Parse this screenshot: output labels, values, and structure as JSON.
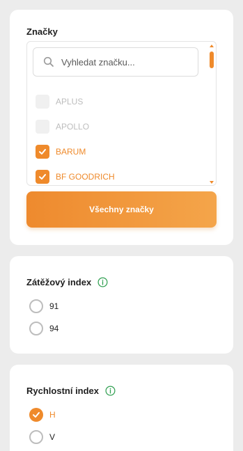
{
  "brands": {
    "title": "Značky",
    "search_placeholder": "Vyhledat značku...",
    "items": [
      {
        "label": "APLUS",
        "checked": false
      },
      {
        "label": "APOLLO",
        "checked": false
      },
      {
        "label": "BARUM",
        "checked": true
      },
      {
        "label": "BF GOODRICH",
        "checked": true
      }
    ],
    "all_button_label": "Všechny značky"
  },
  "load_index": {
    "title": "Zátěžový index",
    "options": [
      {
        "label": "91",
        "checked": false
      },
      {
        "label": "94",
        "checked": false
      }
    ]
  },
  "speed_index": {
    "title": "Rychlostní index",
    "options": [
      {
        "label": "H",
        "checked": true
      },
      {
        "label": "V",
        "checked": false
      }
    ]
  },
  "colors": {
    "accent": "#ef8a2b",
    "info_icon": "#2e9e4f",
    "background": "#ececec",
    "card": "#ffffff"
  }
}
